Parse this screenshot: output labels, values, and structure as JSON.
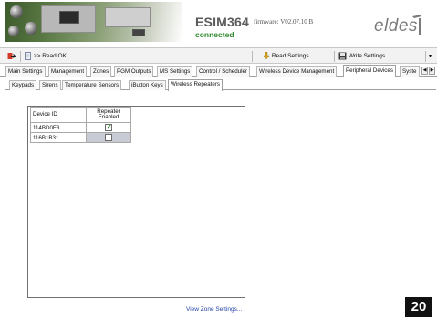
{
  "header": {
    "model": "ESIM364",
    "firmware": "firmware: V02.07.10 B",
    "connection_status": "connected",
    "brand": "eldes"
  },
  "toolbar": {
    "status_text": ">> Read OK",
    "read_settings": "Read Settings",
    "write_settings": "Write Settings"
  },
  "main_tabs": [
    {
      "label": "Main Settings"
    },
    {
      "label": "Management"
    },
    {
      "label": "Zones"
    },
    {
      "label": "PGM Outputs"
    },
    {
      "label": "MS Settings"
    },
    {
      "label": "Control / Scheduler"
    },
    {
      "label": "Wireless Device Management"
    },
    {
      "label": "Peripheral Devices",
      "active": true
    },
    {
      "label": "Syste"
    }
  ],
  "sub_tabs": [
    {
      "label": "Keypads"
    },
    {
      "label": "Sirens"
    },
    {
      "label": "Temperature Sensors"
    },
    {
      "label": "iButton Keys"
    },
    {
      "label": "Wireless Repeaters",
      "active": true
    }
  ],
  "table": {
    "headers": [
      "Device ID",
      "Repeater Enabled"
    ],
    "rows": [
      {
        "device_id": "114BD0E3",
        "enabled": true
      },
      {
        "device_id": "116B1B31",
        "enabled": false
      }
    ]
  },
  "footer": {
    "zone_link": "View Zone Settings...",
    "page_number": "20"
  },
  "colors": {
    "connected": "#2f8a2f",
    "link": "#1f3fa6",
    "selected_cell": "#c9cbd4"
  }
}
